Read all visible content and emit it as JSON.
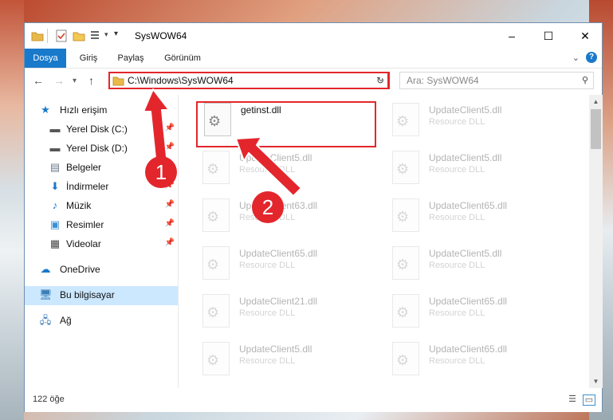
{
  "window": {
    "title": "SysWOW64",
    "minimize_glyph": "–",
    "maximize_glyph": "☐",
    "close_glyph": "✕"
  },
  "ribbon": {
    "tabs": [
      "Dosya",
      "Giriş",
      "Paylaş",
      "Görünüm"
    ],
    "expand_glyph": "⌄",
    "help_glyph": "?"
  },
  "navigation": {
    "address": "C:\\Windows\\SysWOW64",
    "search_placeholder": "Ara: SysWOW64"
  },
  "sidebar": {
    "items": [
      {
        "label": "Hızlı erişim",
        "icon": "star-icon",
        "pinned": false
      },
      {
        "label": "Yerel Disk (C:)",
        "icon": "drive-icon",
        "pinned": true
      },
      {
        "label": "Yerel Disk (D:)",
        "icon": "drive-icon",
        "pinned": true
      },
      {
        "label": "Belgeler",
        "icon": "documents-icon",
        "pinned": true
      },
      {
        "label": "İndirmeler",
        "icon": "downloads-icon",
        "pinned": true
      },
      {
        "label": "Müzik",
        "icon": "music-icon",
        "pinned": true
      },
      {
        "label": "Resimler",
        "icon": "pictures-icon",
        "pinned": true
      },
      {
        "label": "Videolar",
        "icon": "videos-icon",
        "pinned": true
      },
      {
        "label": "OneDrive",
        "icon": "cloud-icon",
        "pinned": false
      },
      {
        "label": "Bu bilgisayar",
        "icon": "computer-icon",
        "pinned": false,
        "selected": true
      },
      {
        "label": "Ağ",
        "icon": "network-icon",
        "pinned": false
      }
    ]
  },
  "files": {
    "highlighted": {
      "name": "getinst.dll"
    },
    "items": [
      {
        "name": "UpdateClient5.dll",
        "type": "Resource DLL"
      },
      {
        "name": "UpdateClient5.dll",
        "type": "Resource DLL"
      },
      {
        "name": "UpdateClient5.dll",
        "type": "Resource DLL"
      },
      {
        "name": "UpdateClient63.dll",
        "type": "Resource DLL"
      },
      {
        "name": "UpdateClient65.dll",
        "type": "Resource DLL"
      },
      {
        "name": "UpdateClient65.dll",
        "type": "Resource DLL"
      },
      {
        "name": "UpdateClient5.dll",
        "type": "Resource DLL"
      },
      {
        "name": "UpdateClient21.dll",
        "type": "Resource DLL"
      },
      {
        "name": "UpdateClient65.dll",
        "type": "Resource DLL"
      },
      {
        "name": "UpdateClient5.dll",
        "type": "Resource DLL"
      },
      {
        "name": "UpdateClient65.dll",
        "type": "Resource DLL"
      }
    ]
  },
  "status": {
    "item_count": "122 öğe"
  },
  "callouts": {
    "step1": "1",
    "step2": "2"
  },
  "colors": {
    "accent": "#1979ca",
    "highlight_red": "#e3262c",
    "selection": "#cce8ff"
  }
}
